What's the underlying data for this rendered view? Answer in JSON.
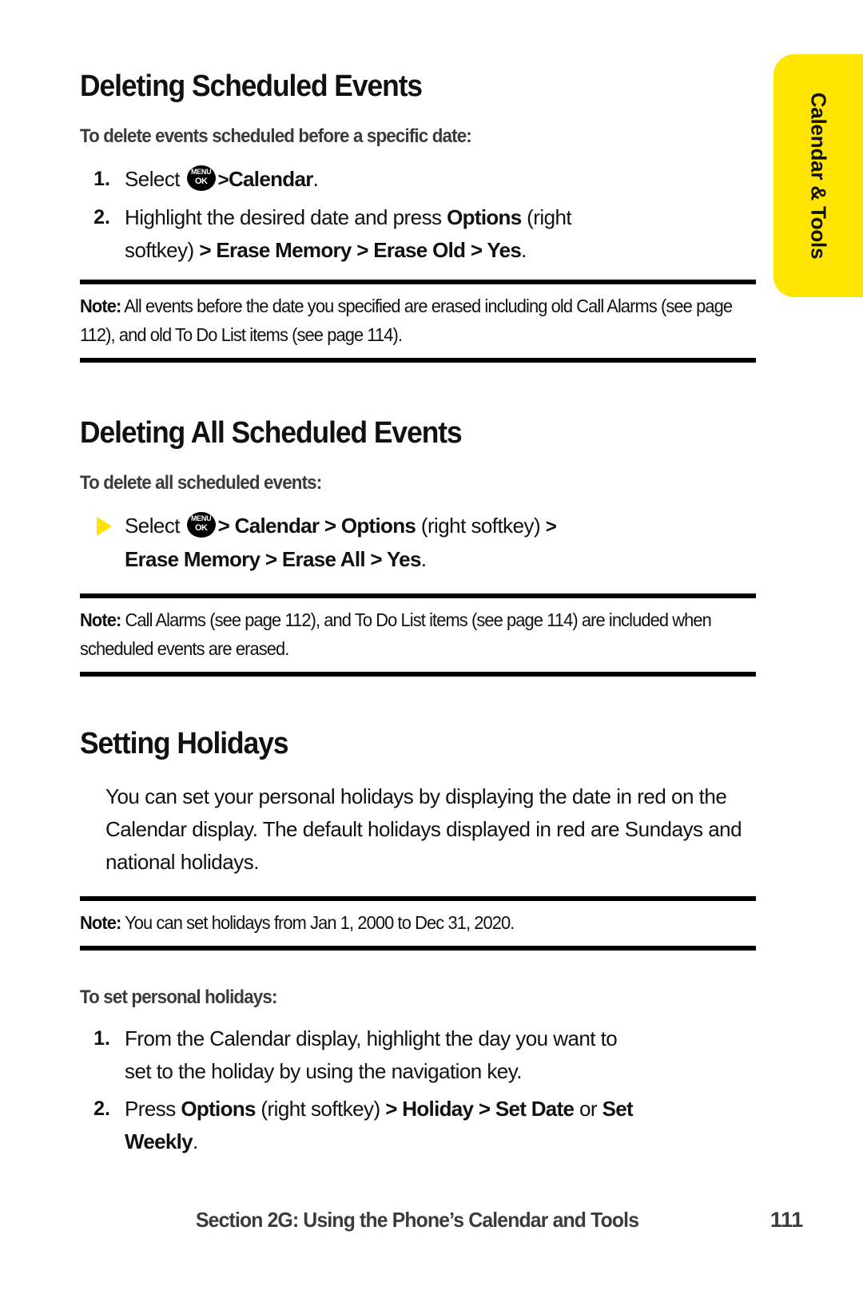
{
  "side_tab": {
    "label": "Calendar & Tools",
    "color": "#ffe400"
  },
  "sections": [
    {
      "title": "Deleting Scheduled Events",
      "subhead": "To delete events scheduled before a specific date:",
      "steps": [
        {
          "marker": "1.",
          "pre": "Select ",
          "icon": "menu-ok-key",
          "post_plain_1": " ",
          "chevron_1": ">",
          "bold_1": "Calendar",
          "tail": "."
        },
        {
          "marker": "2.",
          "line1_plain": "Highlight the desired date and press ",
          "line1_bold": "Options",
          "line1_tail": " (right",
          "line2_plain": "softkey) ",
          "line2_bold_chain": "> Erase Memory > Erase Old > Yes",
          "line2_tail": "."
        }
      ],
      "note": {
        "label": "Note:",
        "text": " All events before the date you specified are erased including old Call Alarms (see page 112), and old To Do List items (see page 114)."
      }
    },
    {
      "title": "Deleting All Scheduled Events",
      "subhead": "To delete all scheduled events:",
      "bullet_step": {
        "marker": "triangle-bullet",
        "line1_plain": "Select ",
        "icon": "menu-ok-key",
        "line1_bold_chain": "> Calendar > Options",
        "line1_plain_2": " (right softkey) ",
        "line1_chevron_end": ">",
        "line2_bold_chain": "Erase Memory > Erase All > Yes",
        "line2_tail": "."
      },
      "note": {
        "label": "Note:",
        "text": " Call Alarms (see page 112), and To Do List items (see page 114) are included when scheduled events are erased."
      }
    },
    {
      "title": "Setting Holidays",
      "paragraph": "You can set your personal holidays by displaying the date in red on the Calendar display. The default holidays displayed in red are Sundays and national holidays.",
      "note": {
        "label": "Note:",
        "text": " You can set holidays from Jan 1, 2000 to Dec 31, 2020."
      },
      "subhead": "To set personal holidays:",
      "steps": [
        {
          "marker": "1.",
          "line1": "From the Calendar display, highlight the day you want to",
          "line2": "set to the holiday by using the navigation key."
        },
        {
          "marker": "2.",
          "line1_plain": "Press ",
          "line1_bold": "Options",
          "line1_plain_2": " (right softkey) ",
          "line1_bold_chain": "> Holiday > Set Date",
          "line1_plain_3": " or ",
          "line1_bold_end": "Set",
          "line2_bold": "Weekly",
          "line2_tail": "."
        }
      ]
    }
  ],
  "menu_key": {
    "top": "MENU",
    "bottom": "OK"
  },
  "footer": {
    "title": "Section 2G: Using the Phone’s Calendar and Tools",
    "page": "111"
  }
}
